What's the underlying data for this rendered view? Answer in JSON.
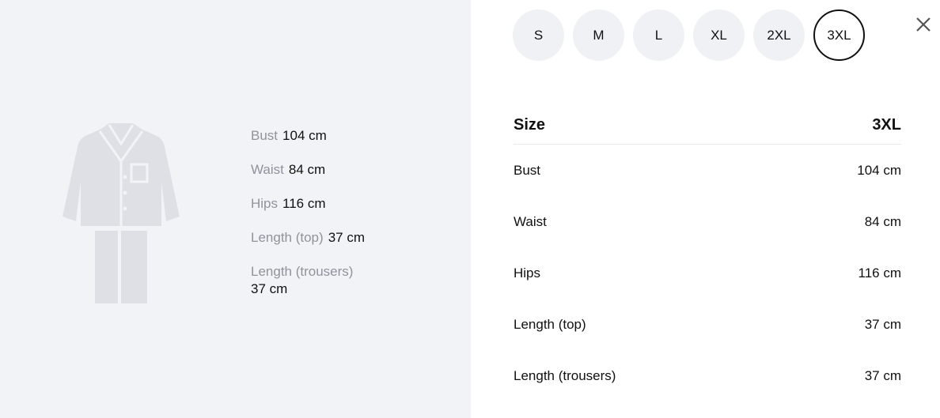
{
  "figure": {
    "icon": "pajama-set-icon",
    "color": "#dfe0e6"
  },
  "measurements": [
    {
      "label": "Bust",
      "value": "104 cm"
    },
    {
      "label": "Waist",
      "value": "84 cm"
    },
    {
      "label": "Hips",
      "value": "116 cm"
    },
    {
      "label": "Length (top)",
      "value": "37 cm"
    },
    {
      "label": "Length (trousers)",
      "value": "37 cm"
    }
  ],
  "sizes": [
    "S",
    "M",
    "L",
    "XL",
    "2XL",
    "3XL"
  ],
  "selected_size": "3XL",
  "close_icon": "close-icon",
  "table": {
    "header_label": "Size",
    "header_value": "3XL",
    "rows": [
      {
        "label": "Bust",
        "value": "104 cm"
      },
      {
        "label": "Waist",
        "value": "84 cm"
      },
      {
        "label": "Hips",
        "value": "116 cm"
      },
      {
        "label": "Length (top)",
        "value": "37 cm"
      },
      {
        "label": "Length (trousers)",
        "value": "37 cm"
      }
    ]
  },
  "colors": {
    "panel_bg": "#f2f3f6",
    "label_gray": "#8f939c",
    "accent": "#111111"
  }
}
